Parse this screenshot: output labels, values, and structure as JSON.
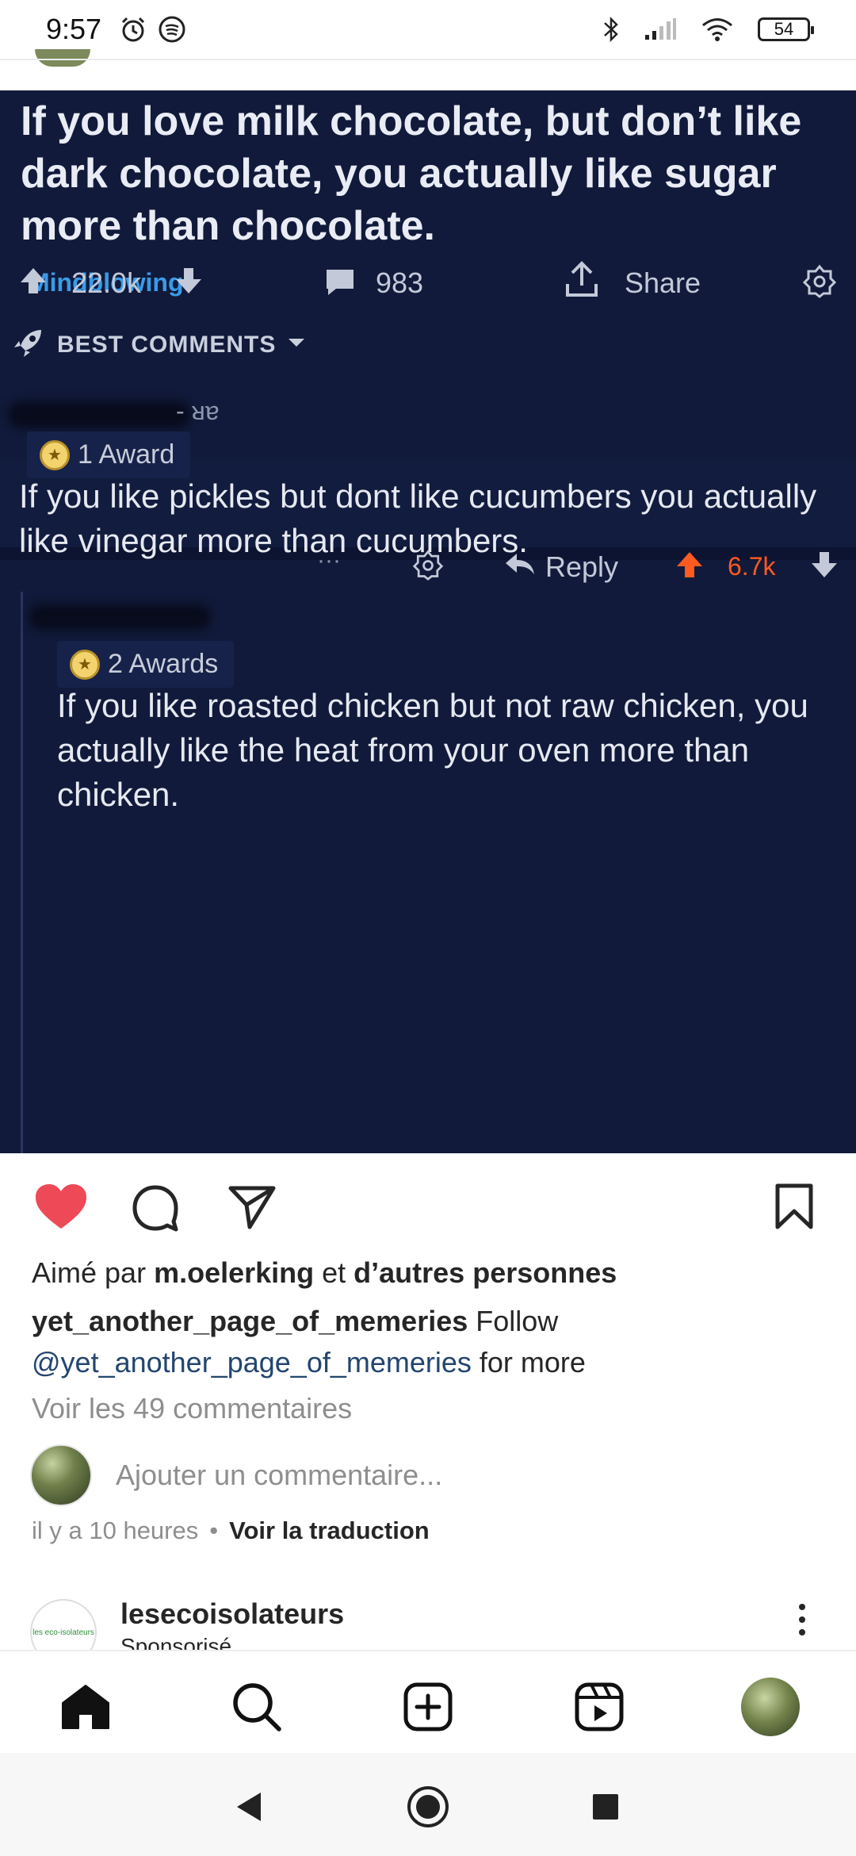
{
  "status_bar": {
    "time": "9:57",
    "battery": "54",
    "icons": [
      "alarm-icon",
      "spotify-icon",
      "bluetooth-icon",
      "signal-icon",
      "wifi-icon",
      "battery-icon"
    ]
  },
  "post": {
    "title": "If you love milk chocolate, but don’t like dark chocolate, you actually like sugar more than chocolate.",
    "flair": "Mindblowing",
    "upvotes": "22.0k",
    "comments": "983",
    "share_label": "Share",
    "sort_label": "BEST COMMENTS",
    "comment1": {
      "author_fragment": "- ᴚɐ",
      "award": "1 Award",
      "text": "If you like pickles but dont like cucumbers you actually like vinegar more than cucumbers.",
      "more": "···",
      "reply_label": "Reply",
      "score": "6.7k"
    },
    "comment2": {
      "award": "2 Awards",
      "text": "If you like roasted chicken but not raw chicken, you actually like the heat from your oven more than chicken."
    }
  },
  "instagram": {
    "liked_by_prefix": "Aimé par ",
    "liked_by_user": "m.oelerking",
    "liked_by_mid": " et ",
    "liked_by_suffix": "d’autres personnes",
    "caption_user": "yet_another_page_of_memeries",
    "caption_text": " Follow ",
    "caption_mention": "@yet_another_page_of_memeries",
    "caption_end": " for more",
    "view_comments": "Voir les 49 commentaires",
    "comment_placeholder": "Ajouter un commentaire...",
    "time_ago": "il y a 10 heures",
    "dot": "•",
    "see_translation": "Voir la traduction",
    "sponsored": {
      "name": "lesecoisolateurs",
      "subtitle": "Sponsorisé",
      "logo_text": "les eco-isolateurs"
    },
    "accent_heart": "#ed4956"
  }
}
